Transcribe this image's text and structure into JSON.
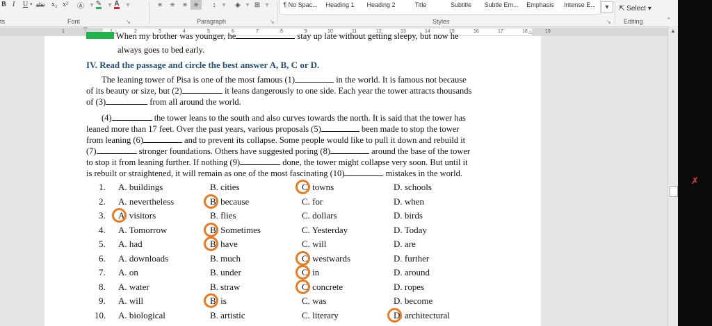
{
  "ribbon": {
    "font_buttons": [
      "B",
      "I",
      "U",
      "abc",
      "x₂",
      "x²"
    ],
    "font_group": "Font",
    "paragraph_group": "Paragraph",
    "styles": [
      "¶ No Spac...",
      "Heading 1",
      "Heading 2",
      "Title",
      "Subtitle",
      "Subtle Em...",
      "Emphasis",
      "Intense E..."
    ],
    "styles_group": "Styles",
    "select_label": "Select",
    "editing_group": "Editing",
    "left_fragment": "ts"
  },
  "ruler": {
    "ticks": [
      "1",
      "1",
      "2",
      "3",
      "4",
      "5",
      "6",
      "7",
      "8",
      "9",
      "10",
      "11",
      "12",
      "13",
      "14",
      "15",
      "16",
      "17",
      "18",
      "19"
    ]
  },
  "doc": {
    "top_cut_left": "When my brother was younger, he",
    "top_cut_right": "stay up late without getting sleepy, but now he",
    "top_tail": "always goes to bed early.",
    "section_title": "IV. Read the passage and circle the best answer A, B, C or D.",
    "para1": [
      [
        "The leaning tower of Pisa is one of the most famous (1)",
        " in the world. It is famous not because"
      ],
      [
        "of its beauty or size, but (2)",
        " it leans dangerously to one side. Each year the tower attracts thousands"
      ],
      [
        "of (3)",
        " from all around the world."
      ]
    ],
    "para2": [
      [
        "(4)",
        " the tower leans to the south and also curves towards the north. It is said that the tower has"
      ],
      [
        "leaned more than 17 feet. Over the past years, various proposals (5)",
        " been made to stop the tower"
      ],
      [
        "from leaning (6)",
        " and to prevent its collapse. Some people would like to pull it down and rebuild it"
      ],
      [
        "(7)",
        " stronger foundations. Others have suggested poring (8)",
        " around the base of the tower"
      ],
      [
        "to stop it from leaning further. If nothing (9)",
        " done, the tower might collapse very soon. But until it"
      ],
      [
        "is rebuilt or straightened, it will remain as one of the most fascinating (10)",
        " mistakes in the world."
      ]
    ],
    "questions": [
      {
        "num": "1.",
        "a": "A. buildings",
        "b": "B. cities",
        "c": "C. towns",
        "d": "D. schools",
        "circled": "C"
      },
      {
        "num": "2.",
        "a": "A. nevertheless",
        "b": "B. because",
        "c": "C. for",
        "d": "D. when",
        "circled": "B"
      },
      {
        "num": "3.",
        "a": "A. visitors",
        "b": "B. flies",
        "c": "C. dollars",
        "d": "D. birds",
        "circled": "A"
      },
      {
        "num": "4.",
        "a": "A. Tomorrow",
        "b": "B. Sometimes",
        "c": "C. Yesterday",
        "d": "D. Today",
        "circled": "B"
      },
      {
        "num": "5.",
        "a": "A. had",
        "b": "B. have",
        "c": "C. will",
        "d": "D. are",
        "circled": "B"
      },
      {
        "num": "6.",
        "a": "A. downloads",
        "b": "B. much",
        "c": "C. westwards",
        "d": "D. further",
        "circled": "C"
      },
      {
        "num": "7.",
        "a": "A. on",
        "b": "B. under",
        "c": "C. in",
        "d": "D. around",
        "circled": "C"
      },
      {
        "num": "8.",
        "a": "A. water",
        "b": "B. straw",
        "c": "C. concrete",
        "d": "D. ropes",
        "circled": "C"
      },
      {
        "num": "9.",
        "a": "A. will",
        "b": "B. is",
        "c": "C. was",
        "d": "D. become",
        "circled": "B"
      },
      {
        "num": "10.",
        "a": "A. biological",
        "b": "B. artistic",
        "c": "C. literary",
        "d": "D. architectural",
        "circled": "D"
      }
    ]
  },
  "colors": {
    "title": "#1f4e79",
    "circle": "#ea7a20",
    "highlight": "#22b14c"
  }
}
